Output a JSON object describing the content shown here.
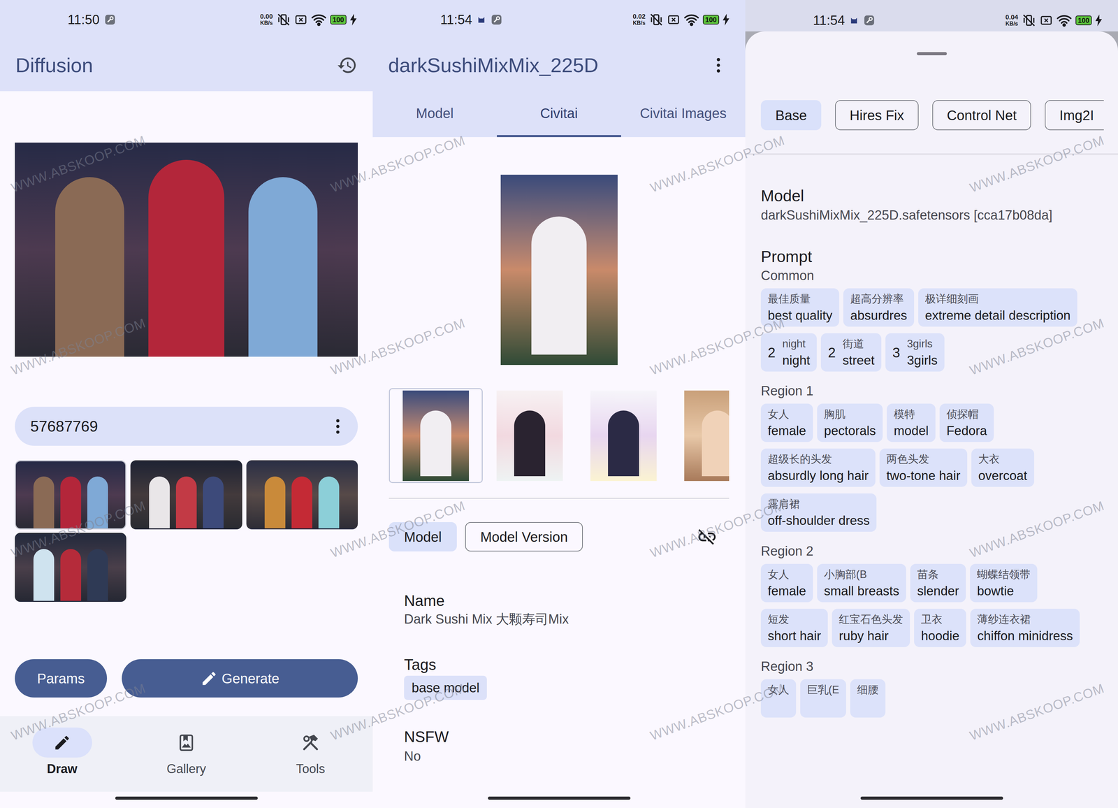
{
  "watermarks": [
    "WWW.ABSKOOP.COM",
    "WWW.ABSKOOP.COM",
    "WWW.ABSKOOP.COM",
    "WWW.ABSKOOP.COM",
    "WWW.ABSKOOP.COM",
    "WWW.ABSKOOP.COM",
    "WWW.ABSKOOP.COM",
    "WWW.ABSKOOP.COM",
    "WWW.ABSKOOP.COM",
    "WWW.ABSKOOP.COM",
    "WWW.ABSKOOP.COM",
    "WWW.ABSKOOP.COM",
    "WWW.ABSKOOP.COM",
    "WWW.ABSKOOP.COM",
    "WWW.ABSKOOP.COM",
    "WWW.ABSKOOP.COM"
  ],
  "draw_screen": {
    "status_bar": {
      "time": "11:50",
      "net_speed": "0.00",
      "net_unit": "KB/s",
      "battery": "100"
    },
    "title": "Diffusion",
    "seed": "57687769",
    "results": [
      {
        "selected": true
      },
      {
        "selected": false
      },
      {
        "selected": false
      },
      {
        "selected": false
      }
    ],
    "params_button": "Params",
    "generate_button": "Generate",
    "nav": [
      {
        "label": "Draw",
        "selected": true
      },
      {
        "label": "Gallery",
        "selected": false
      },
      {
        "label": "Tools",
        "selected": false
      }
    ]
  },
  "model_screen": {
    "status_bar": {
      "time": "11:54",
      "net_speed": "0.02",
      "net_unit": "KB/s",
      "battery": "100"
    },
    "title": "darkSushiMixMix_225D",
    "tabs": [
      {
        "label": "Model",
        "selected": false
      },
      {
        "label": "Civitai",
        "selected": true
      },
      {
        "label": "Civitai Images",
        "selected": false
      }
    ],
    "images": [
      {
        "selected": true
      },
      {
        "selected": false
      },
      {
        "selected": false
      },
      {
        "selected": false
      }
    ],
    "info_tabs": [
      {
        "label": "Model",
        "selected": true
      },
      {
        "label": "Model Version",
        "selected": false
      }
    ],
    "fields": {
      "name_label": "Name",
      "name": "Dark Sushi Mix 大颗寿司Mix",
      "tags_label": "Tags",
      "tags": [
        "base model"
      ],
      "nsfw_label": "NSFW",
      "nsfw": "No"
    }
  },
  "params_sheet": {
    "status_bar": {
      "time": "11:54",
      "net_speed": "0.04",
      "net_unit": "KB/s",
      "battery": "100"
    },
    "tabs": [
      {
        "label": "Base",
        "selected": true
      },
      {
        "label": "Hires Fix",
        "selected": false
      },
      {
        "label": "Control Net",
        "selected": false
      },
      {
        "label": "Img2I",
        "selected": false
      }
    ],
    "model_label": "Model",
    "model": "darkSushiMixMix_225D.safetensors [cca17b08da]",
    "prompt_label": "Prompt",
    "sections": [
      {
        "title": "Common",
        "tags": [
          {
            "cn": "最佳质量",
            "en": "best quality"
          },
          {
            "cn": "超高分辨率",
            "en": "absurdres"
          },
          {
            "cn": "极详细刻画",
            "en": "extreme detail description"
          },
          {
            "weight": "2",
            "cn": "night",
            "en": "night"
          },
          {
            "weight": "2",
            "cn": "街道",
            "en": "street"
          },
          {
            "weight": "3",
            "cn": "3girls",
            "en": "3girls"
          }
        ]
      },
      {
        "title": "Region 1",
        "tags": [
          {
            "cn": "女人",
            "en": "female"
          },
          {
            "cn": "胸肌",
            "en": "pectorals"
          },
          {
            "cn": "模特",
            "en": "model"
          },
          {
            "cn": "侦探帽",
            "en": "Fedora"
          },
          {
            "cn": "超级长的头发",
            "en": "absurdly long hair"
          },
          {
            "cn": "两色头发",
            "en": "two-tone hair"
          },
          {
            "cn": "大衣",
            "en": "overcoat"
          },
          {
            "cn": "露肩裙",
            "en": "off-shoulder dress"
          }
        ]
      },
      {
        "title": "Region 2",
        "tags": [
          {
            "cn": "女人",
            "en": "female"
          },
          {
            "cn": "小胸部(B",
            "en": "small breasts"
          },
          {
            "cn": "苗条",
            "en": "slender"
          },
          {
            "cn": "蝴蝶结领带",
            "en": "bowtie"
          },
          {
            "cn": "短发",
            "en": "short hair"
          },
          {
            "cn": "红宝石色头发",
            "en": "ruby hair"
          },
          {
            "cn": "卫衣",
            "en": "hoodie"
          },
          {
            "cn": "薄纱连衣裙",
            "en": "chiffon minidress"
          }
        ]
      },
      {
        "title": "Region 3",
        "tags": [
          {
            "cn": "女人"
          },
          {
            "cn": "巨乳(E"
          },
          {
            "cn": "细腰"
          }
        ]
      }
    ]
  }
}
